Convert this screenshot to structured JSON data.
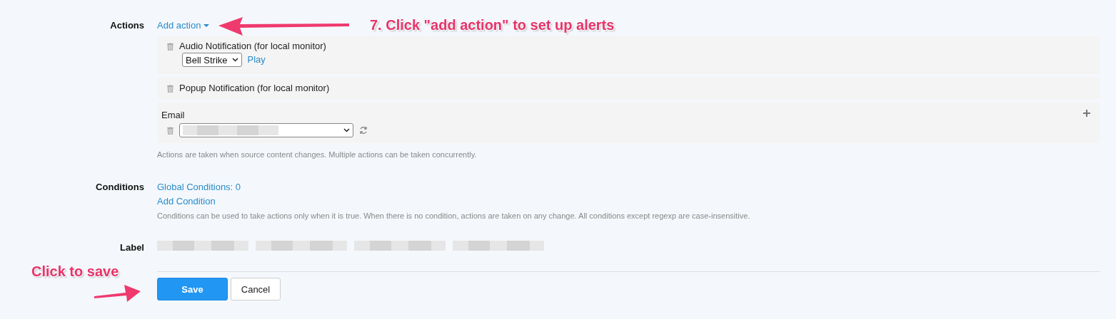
{
  "actions": {
    "label": "Actions",
    "add_link": "Add action",
    "items": [
      {
        "kind": "audio",
        "title": "Audio Notification (for local monitor)",
        "sound": "Bell Strike",
        "play": "Play"
      },
      {
        "kind": "popup",
        "title": "Popup Notification (for local monitor)"
      },
      {
        "kind": "email",
        "title": "Email"
      }
    ],
    "help": "Actions are taken when source content changes. Multiple actions can be taken concurrently."
  },
  "conditions": {
    "label": "Conditions",
    "global_link": "Global Conditions: 0",
    "add_link": "Add Condition",
    "help": "Conditions can be used to take actions only when it is true. When there is no condition, actions are taken on any change. All conditions except regexp are case-insensitive."
  },
  "label_field": {
    "label": "Label"
  },
  "buttons": [
    {
      "kind": "primary",
      "label": "Save"
    },
    {
      "kind": "default",
      "label": "Cancel"
    }
  ],
  "annotations": [
    {
      "kind": "top",
      "text": "7. Click \"add action\" to set up alerts"
    },
    {
      "kind": "save",
      "text": "Click to save"
    }
  ]
}
